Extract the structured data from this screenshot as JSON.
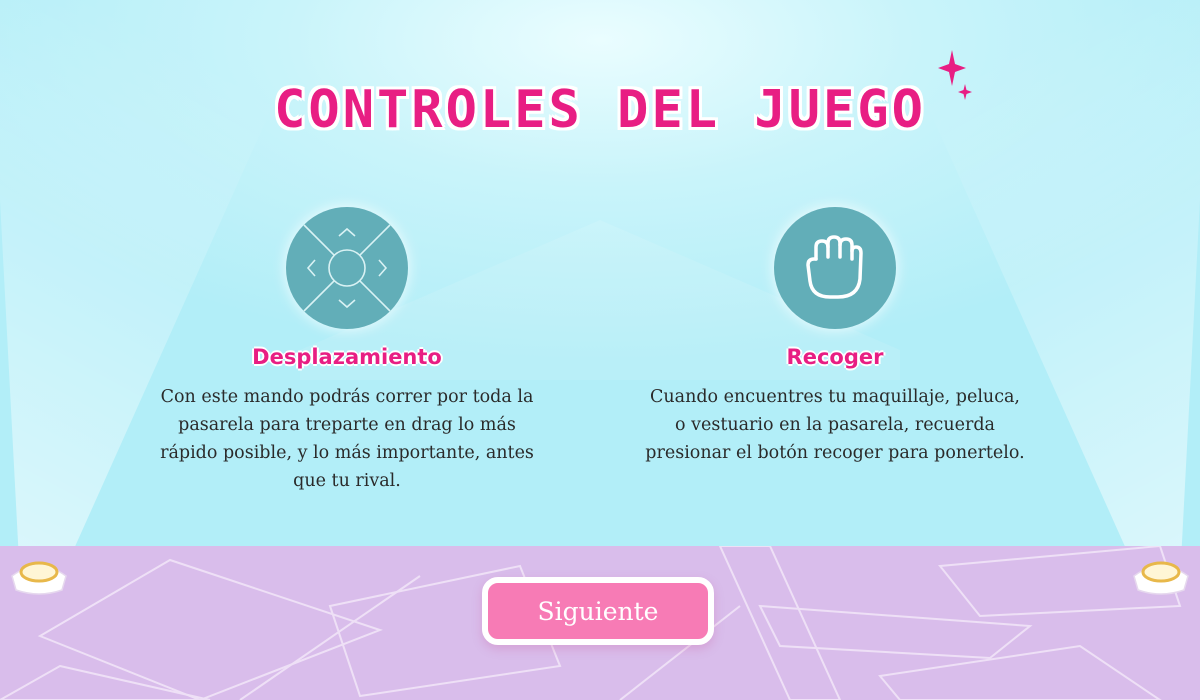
{
  "screen": {
    "title": "CONTROLES DEL JUEGO"
  },
  "controls": [
    {
      "icon": "dpad-icon",
      "label": "Desplazamiento",
      "description": "Con este mando podrás correr por toda la pasarela para treparte en drag lo más rápido posible, y lo más importante, antes que tu rival."
    },
    {
      "icon": "grab-hand-icon",
      "label": "Recoger",
      "description": "Cuando encuentres tu maquillaje, peluca, o vestuario en la pasarela, recuerda presionar el botón recoger para ponertelo."
    }
  ],
  "next_button": {
    "label": "Siguiente"
  },
  "colors": {
    "accent": "#e81e83",
    "icon_circle": "#62aeb8",
    "button": "#f77bb5",
    "floor": "#d9bdeb",
    "sky": "#b2eef8"
  }
}
